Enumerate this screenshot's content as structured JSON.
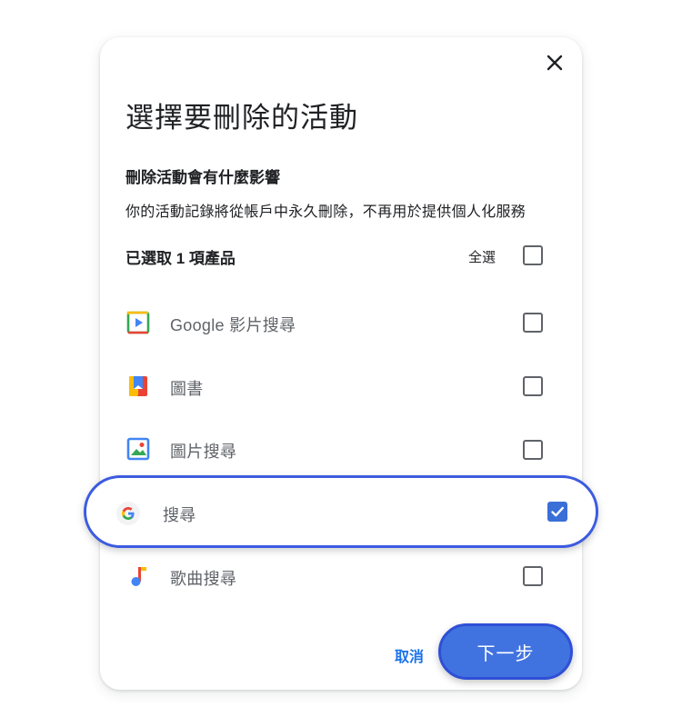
{
  "dialog": {
    "title": "選擇要刪除的活動",
    "subheading": "刪除活動會有什麼影響",
    "description": "你的活動記錄將從帳戶中永久刪除，不再用於提供個人化服務",
    "selected_count": "已選取 1 項產品",
    "select_all_label": "全選",
    "select_all_checked": false,
    "items": [
      {
        "label": "Google 影片搜尋",
        "icon": "video-search-icon",
        "checked": false
      },
      {
        "label": "圖書",
        "icon": "books-icon",
        "checked": false
      },
      {
        "label": "圖片搜尋",
        "icon": "image-search-icon",
        "checked": false
      },
      {
        "label": "搜尋",
        "icon": "google-g-icon",
        "checked": true
      },
      {
        "label": "歌曲搜尋",
        "icon": "music-note-icon",
        "checked": false
      }
    ],
    "cancel_label": "取消",
    "next_label": "下一步",
    "close_icon": "close-icon"
  },
  "colors": {
    "accent": "#1a73e8",
    "button_fill": "#4173e0",
    "highlight_border": "#3c5be0",
    "checkbox_checked": "#3a6fd8"
  }
}
